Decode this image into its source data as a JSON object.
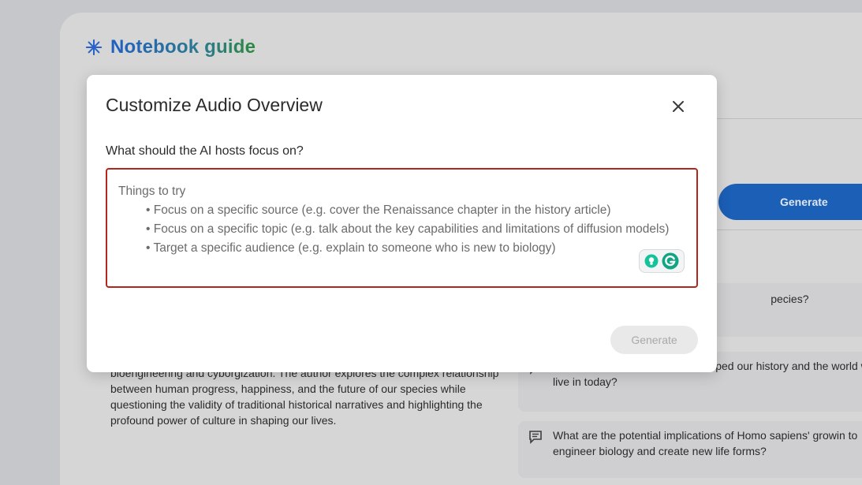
{
  "guide": {
    "title": "Notebook guide",
    "generate_label": "Generate",
    "summary": "bioengineering and cyborgization. The author explores the complex relationship between human progress, happiness, and the future of our species while questioning the validity of traditional historical narratives and highlighting the profound power of culture in shaping our lives.",
    "questions": [
      "ed to the rise of Homo sapie                          pecies?",
      "piens to create imagined real shaped our history and the world we live in today?",
      "What are the potential implications of Homo sapiens' growin to engineer biology and create new life forms?"
    ]
  },
  "dialog": {
    "title": "Customize Audio Overview",
    "prompt_label": "What should the AI hosts focus on?",
    "placeholder": {
      "heading": "Things to try",
      "bullets": [
        "• Focus on a specific source (e.g. cover the Renaissance chapter in the history article)",
        "• Focus on a specific topic (e.g. talk about the key capabilities and limitations of diffusion models)",
        "• Target a specific audience (e.g. explain to someone who is new to biology)"
      ]
    },
    "generate_label": "Generate"
  },
  "colors": {
    "accent_blue": "#1b5fb6",
    "error_border": "#b3261e",
    "grammarly_green": "#15c39a"
  },
  "icons": {
    "header": "sparkle-icon",
    "close": "close-icon",
    "question": "note-icon",
    "grammar": "grammarly-icon"
  }
}
